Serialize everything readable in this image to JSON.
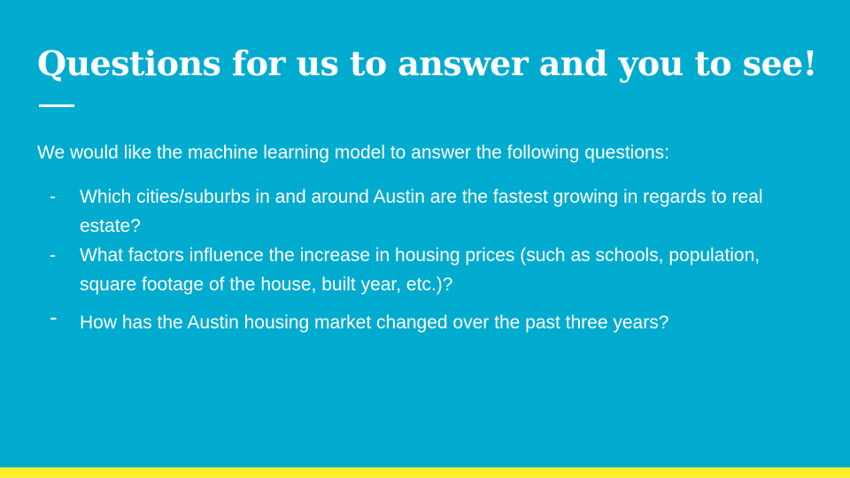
{
  "slide": {
    "title": "Questions for us to answer and you to see!",
    "intro": "We would like the machine learning model to answer the following questions:",
    "questions": [
      {
        "marker": "-",
        "text": "Which cities/suburbs in and around Austin are the fastest growing in regards to real estate?"
      },
      {
        "marker": "-",
        "text": "What factors influence the increase in housing prices (such as schools, population, square footage of the house, built year, etc.)?"
      },
      {
        "marker": "-",
        "text": "How has the Austin housing market changed over the past three years?"
      }
    ]
  },
  "colors": {
    "background": "#00abd0",
    "text": "#ffffff",
    "accent_bar": "#fff02b"
  }
}
